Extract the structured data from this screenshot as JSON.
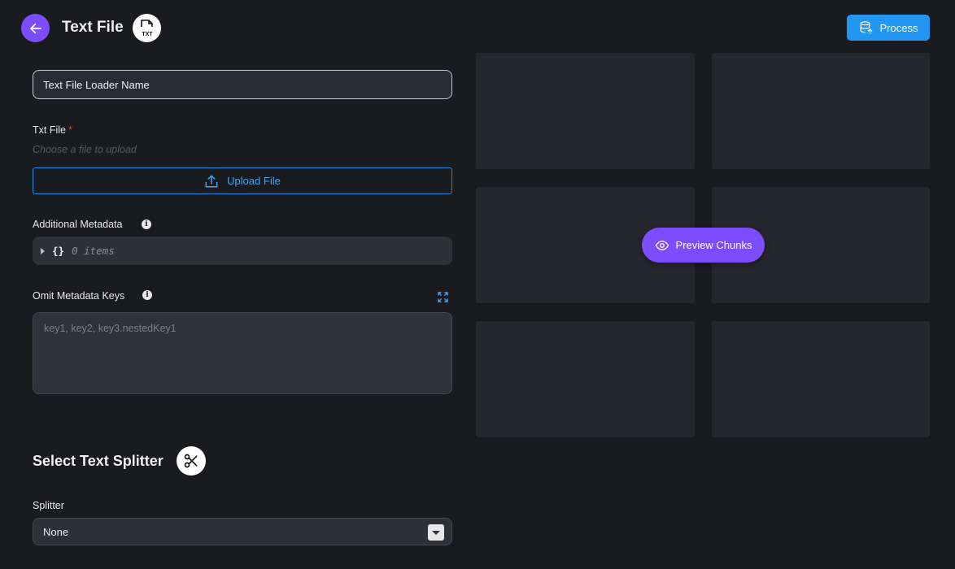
{
  "header": {
    "title": "Text File",
    "file_badge": "TXT",
    "process_label": "Process"
  },
  "form": {
    "name_value": "Text File Loader Name",
    "txt_file_label": "Txt File",
    "required_mark": "*",
    "upload_hint": "Choose a file to upload",
    "upload_button": "Upload File",
    "additional_metadata_label": "Additional Metadata",
    "metadata_brace": "{}",
    "metadata_count": "0 items",
    "omit_keys_label": "Omit Metadata Keys",
    "omit_keys_placeholder": "key1, key2, key3.nestedKey1"
  },
  "splitter": {
    "section_title": "Select Text Splitter",
    "label": "Splitter",
    "selected": "None"
  },
  "preview": {
    "button_label": "Preview Chunks"
  },
  "colors": {
    "accent_purple": "#7c4dff",
    "accent_blue": "#2196f3",
    "background": "#1a1b1f",
    "tile": "#25272d"
  }
}
